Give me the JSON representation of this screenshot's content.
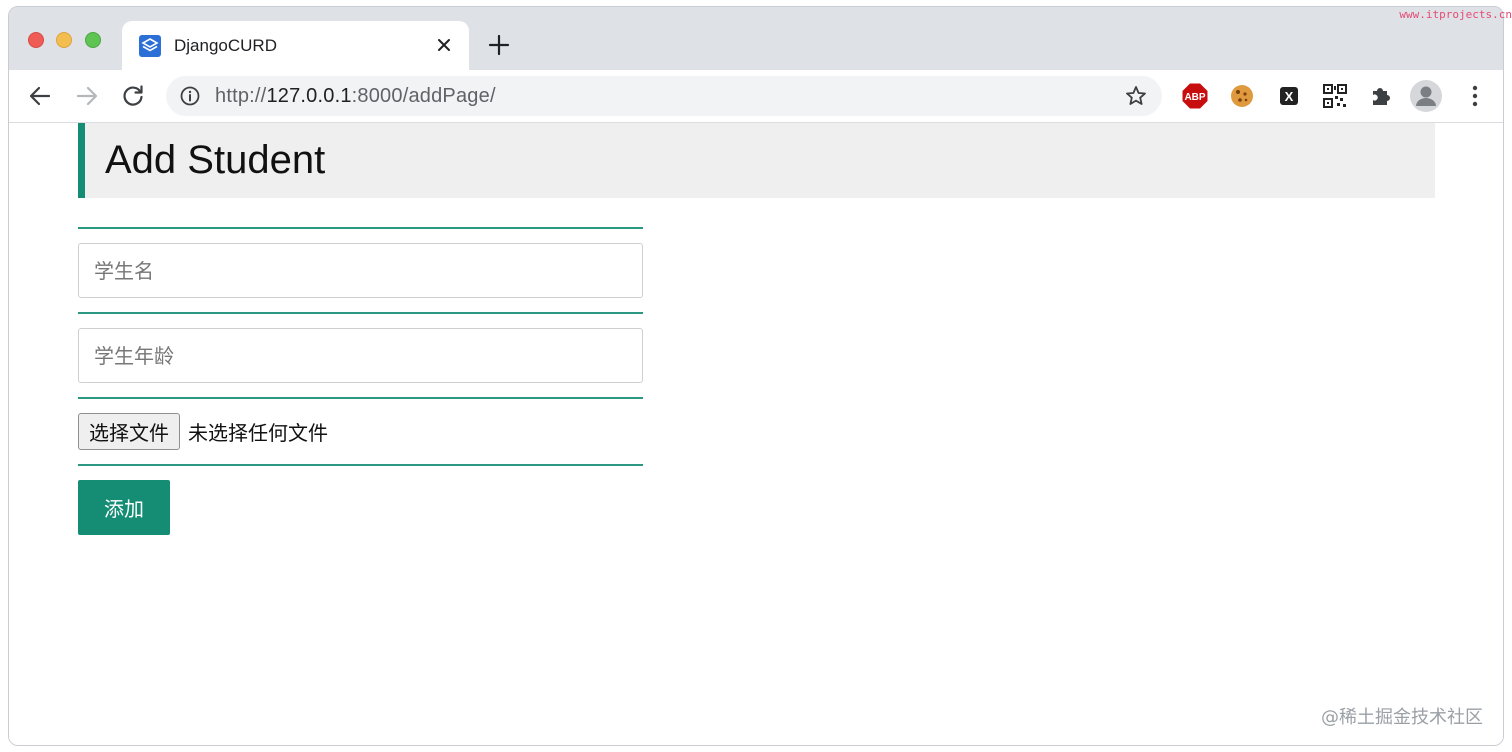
{
  "browser": {
    "tab_title": "DjangoCURD",
    "url_scheme": "http://",
    "url_host": "127.0.0.1",
    "url_rest": ":8000/addPage/",
    "extensions": [
      "adblock-plus-icon",
      "cookie-icon",
      "x-icon",
      "qr-code-icon",
      "extensions-puzzle-icon",
      "profile-avatar-icon",
      "menu-kebab-icon"
    ],
    "abp_label": "ABP",
    "x_label": "X"
  },
  "page": {
    "heading": "Add Student",
    "form": {
      "name_placeholder": "学生名",
      "age_placeholder": "学生年龄",
      "file_button_label": "选择文件",
      "file_status": "未选择任何文件",
      "submit_label": "添加"
    },
    "accent_color": "#148d74"
  },
  "watermarks": {
    "top": "www.itprojects.cn",
    "bottom": "@稀土掘金技术社区"
  }
}
